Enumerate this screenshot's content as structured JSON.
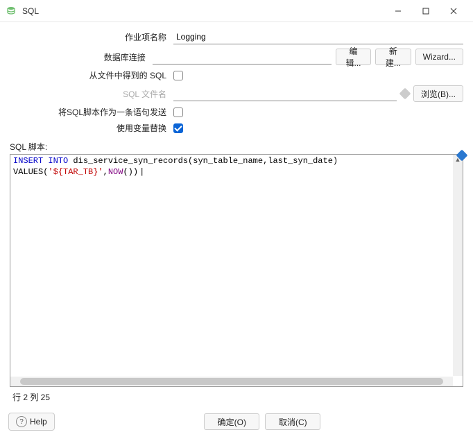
{
  "window": {
    "title": "SQL"
  },
  "labels": {
    "job_name": "作业项名称",
    "db_connection": "数据库连接",
    "sql_from_file": "从文件中得到的 SQL",
    "sql_filename": "SQL 文件名",
    "send_as_single": "将SQL脚本作为一条语句发送",
    "use_var_subst": "使用变量替换",
    "sql_script": "SQL 脚本:"
  },
  "values": {
    "job_name": "Logging",
    "db_connection": ""
  },
  "placeholders": {
    "sql_filename": ""
  },
  "buttons": {
    "edit": "编辑...",
    "new": "新建...",
    "wizard": "Wizard...",
    "browse": "浏览(B)...",
    "help": "Help",
    "ok": "确定(O)",
    "cancel": "取消(C)"
  },
  "checks": {
    "sql_from_file": false,
    "send_as_single": false,
    "use_var_subst": true
  },
  "sql": {
    "kw_insert": "INSERT INTO",
    "table_ref": " dis_service_syn_records",
    "open_paren": "(",
    "cols": "syn_table_name",
    "comma1": ",",
    "cols2": "last_syn_date",
    "close_paren": ")",
    "values_kw": "VALUES(",
    "str_lit": "'${TAR_TB}'",
    "comma2": ",",
    "now_fn": "NOW",
    "tail": "())"
  },
  "status": {
    "cursor": "行 2 列 25"
  }
}
